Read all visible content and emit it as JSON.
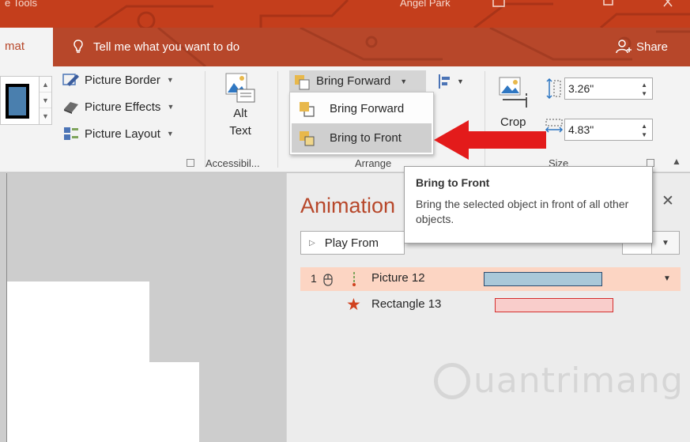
{
  "titlebar": {
    "tool_label": "e Tools",
    "user_name": "Angel Park"
  },
  "tabs": {
    "format_label": "mat",
    "tell_me": "Tell me what you want to do",
    "share_label": "Share"
  },
  "ribbon": {
    "picture_border": "Picture Border",
    "picture_effects": "Picture Effects",
    "picture_layout": "Picture Layout",
    "alt_text_line1": "Alt",
    "alt_text_line2": "Text",
    "accessibility_group": "Accessibil...",
    "bring_forward": "Bring Forward",
    "arrange_group": "Arrange",
    "crop_label": "Crop",
    "height_value": "3.26\"",
    "width_value": "4.83\"",
    "size_group": "Size"
  },
  "dropdown": {
    "items": [
      {
        "label": "Bring Forward"
      },
      {
        "label": "Bring to Front"
      }
    ]
  },
  "tooltip": {
    "title": "Bring to Front",
    "body": "Bring the selected object in front of all other objects."
  },
  "animation_pane": {
    "title": "Animation",
    "play_from": "Play From",
    "rows": [
      {
        "order": "1",
        "name": "Picture 12"
      },
      {
        "name": "Rectangle 13"
      }
    ]
  },
  "watermark": "uantrimang",
  "colors": {
    "accent": "#b7472a",
    "titlebar": "#c43e1c",
    "highlight_row": "#fcd5c3",
    "arrow": "#e31b1b"
  }
}
